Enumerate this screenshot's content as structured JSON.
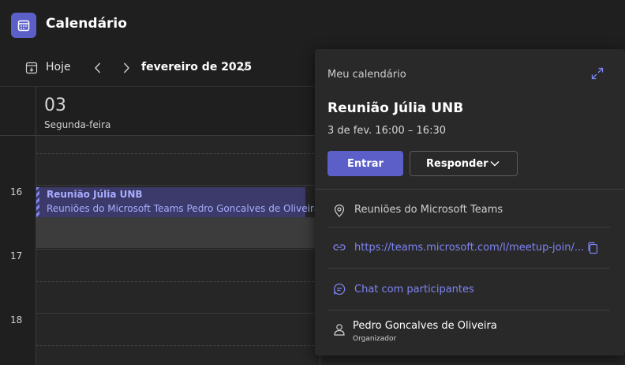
{
  "app": {
    "title": "Calendário",
    "icon": "calendar-icon",
    "accent": "#5b5fc7"
  },
  "toolbar": {
    "today_label": "Hoje",
    "month_label": "fevereiro de 2025"
  },
  "day": {
    "number": "03",
    "name": "Segunda-feira"
  },
  "hours": [
    "16",
    "17",
    "18"
  ],
  "event": {
    "title": "Reunião Júlia UNB",
    "subtitle": "Reuniões do Microsoft Teams  Pedro Goncalves de Oliveira",
    "color": "#3b3a6a"
  },
  "popup": {
    "calendar_name": "Meu calendário",
    "title": "Reunião Júlia UNB",
    "time": "3 de fev. 16:00 – 16:30",
    "join_label": "Entrar",
    "respond_label": "Responder",
    "location": "Reuniões do Microsoft Teams",
    "link": "https://teams.microsoft.com/l/meetup-join/...",
    "chat_label": "Chat com participantes",
    "organizer_name": "Pedro Goncalves de Oliveira",
    "organizer_role": "Organizador",
    "link_color": "#7f85f5"
  }
}
